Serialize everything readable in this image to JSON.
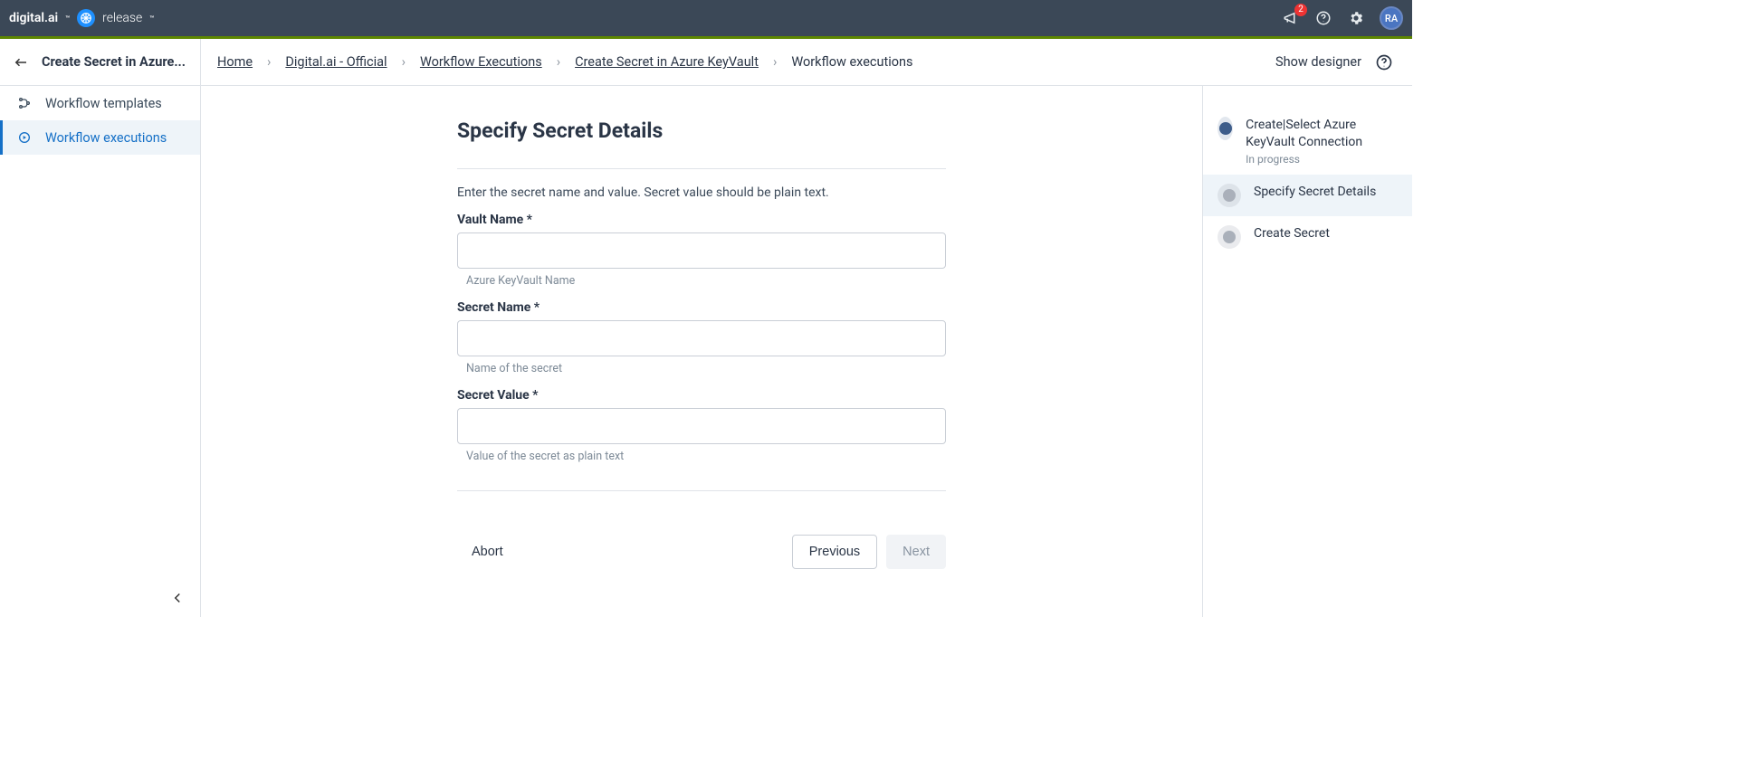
{
  "header": {
    "brand_logo_text": "digital.ai",
    "product_text": "release",
    "notif_badge": "2",
    "avatar_initials": "RA"
  },
  "subheader": {
    "back_title": "Create Secret in Azure...",
    "breadcrumb": [
      "Home",
      "Digital.ai - Official",
      "Workflow Executions",
      "Create Secret in Azure KeyVault",
      "Workflow executions"
    ],
    "show_designer": "Show designer"
  },
  "sidebar": {
    "items": [
      {
        "label": "Workflow templates",
        "active": false
      },
      {
        "label": "Workflow executions",
        "active": true
      }
    ]
  },
  "main": {
    "title": "Specify Secret Details",
    "description": "Enter the secret name and value. Secret value should be plain text.",
    "fields": {
      "vaultName": {
        "label": "Vault Name",
        "help": "Azure KeyVault Name",
        "value": ""
      },
      "secretName": {
        "label": "Secret Name",
        "help": "Name of the secret",
        "value": ""
      },
      "secretValue": {
        "label": "Secret Value",
        "help": "Value of the secret as plain text",
        "value": ""
      }
    },
    "buttons": {
      "abort": "Abort",
      "prev": "Previous",
      "next": "Next"
    }
  },
  "rail": {
    "steps": [
      {
        "label": "Create|Select Azure KeyVault Connection",
        "sub": "In progress",
        "state": "done"
      },
      {
        "label": "Specify Secret Details",
        "sub": "",
        "state": "active"
      },
      {
        "label": "Create Secret",
        "sub": "",
        "state": "todo"
      }
    ]
  },
  "required_mark": " *"
}
